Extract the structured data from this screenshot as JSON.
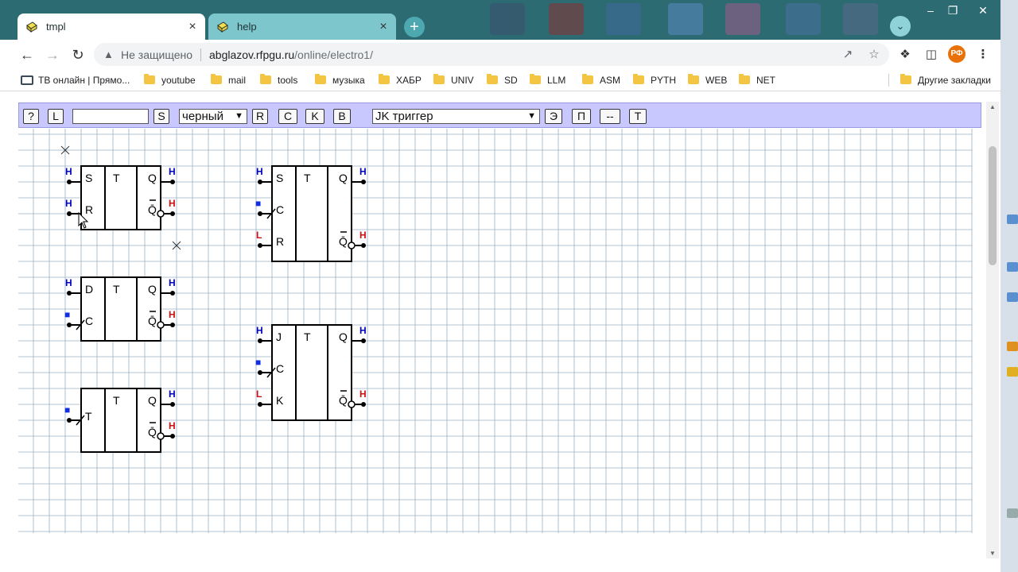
{
  "tabs": [
    {
      "title": "tmpl",
      "close": "×"
    },
    {
      "title": "help",
      "close": "×"
    }
  ],
  "new_tab": "+",
  "address": {
    "security": "Не защищено",
    "host": "abglazov.rfpgu.ru",
    "path": "/online/electro1/"
  },
  "profile": "РФ",
  "bookmarks": [
    "ТВ онлайн | Прямо...",
    "youtube",
    "mail",
    "tools",
    "музыка",
    "ХАБР",
    "UNIV",
    "SD",
    "LLM",
    "ASM",
    "PYTH",
    "WEB",
    "NET"
  ],
  "other_bookmarks": "Другие закладки",
  "app_toolbar": {
    "help": "?",
    "load": "L",
    "input_value": "",
    "save": "S",
    "color_select": "черный",
    "r": "R",
    "c": "C",
    "k": "K",
    "b": "B",
    "element_select": "JK триггер",
    "e": "Э",
    "p": "П",
    "dash": "--",
    "t": "T"
  },
  "colors": {
    "high": "#0000c0",
    "low": "#d01010",
    "input_blue": "#1030e0",
    "grid": "#9ab0c4",
    "toolbar_bg": "#c8c8ff"
  },
  "circuit": {
    "triggers": [
      {
        "kind": "RS",
        "title": "T",
        "left_labels": [
          "S",
          "R"
        ],
        "right_labels": [
          "Q",
          "Q̄"
        ],
        "pin_markers": [
          "Н",
          "Н"
        ],
        "out_markers": [
          "Н",
          "Н"
        ]
      },
      {
        "kind": "SCR",
        "title": "T",
        "left_labels": [
          "S",
          "C",
          "R"
        ],
        "right_labels": [
          "Q",
          "Q̄"
        ],
        "pin_markers": [
          "Н",
          "■",
          "L"
        ],
        "out_markers": [
          "Н",
          "Н"
        ]
      },
      {
        "kind": "D",
        "title": "T",
        "left_labels": [
          "D",
          "C"
        ],
        "right_labels": [
          "Q",
          "Q̄"
        ],
        "pin_markers": [
          "Н",
          "■"
        ],
        "out_markers": [
          "Н",
          "Н"
        ]
      },
      {
        "kind": "JK",
        "title": "T",
        "left_labels": [
          "J",
          "C",
          "K"
        ],
        "right_labels": [
          "Q",
          "Q̄"
        ],
        "pin_markers": [
          "Н",
          "■",
          "L"
        ],
        "out_markers": [
          "Н",
          "Н"
        ]
      },
      {
        "kind": "T",
        "title": "T",
        "left_labels": [
          "T"
        ],
        "right_labels": [
          "Q",
          "Q̄"
        ],
        "pin_markers": [
          "■"
        ],
        "out_markers": [
          "Н",
          "Н"
        ]
      }
    ]
  }
}
